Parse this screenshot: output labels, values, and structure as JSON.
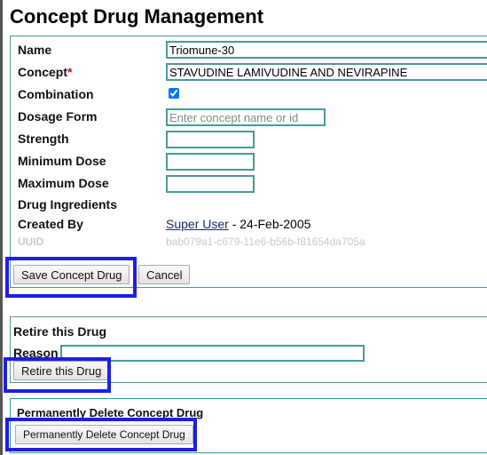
{
  "page": {
    "title": "Concept Drug Management"
  },
  "form": {
    "name": {
      "label": "Name",
      "value": "Triomune-30"
    },
    "concept": {
      "label": "Concept",
      "required_marker": "*",
      "value": "STAVUDINE LAMIVUDINE AND NEVIRAPINE"
    },
    "combination": {
      "label": "Combination",
      "checked": true
    },
    "dosage_form": {
      "label": "Dosage Form",
      "value": "",
      "placeholder": "Enter concept name or id"
    },
    "strength": {
      "label": "Strength",
      "value": ""
    },
    "minimum_dose": {
      "label": "Minimum Dose",
      "value": ""
    },
    "maximum_dose": {
      "label": "Maximum Dose",
      "value": ""
    },
    "drug_ingredients": {
      "label": "Drug Ingredients"
    },
    "created_by": {
      "label": "Created By",
      "user": "Super User",
      "date_text": " - 24-Feb-2005"
    },
    "uuid": {
      "label": "UUID",
      "value": "bab079a1-c679-11e6-b56b-f81654da705a"
    },
    "buttons": {
      "save": "Save Concept Drug",
      "cancel": "Cancel"
    }
  },
  "retire": {
    "title": "Retire this Drug",
    "reason_label": "Reason",
    "reason_value": "",
    "button": "Retire this Drug"
  },
  "delete": {
    "title": "Permanently Delete Concept Drug",
    "button": "Permanently Delete Concept Drug"
  },
  "colors": {
    "border": "#4a9a94",
    "highlight": "#1e1ee6",
    "required": "#ee0000"
  }
}
